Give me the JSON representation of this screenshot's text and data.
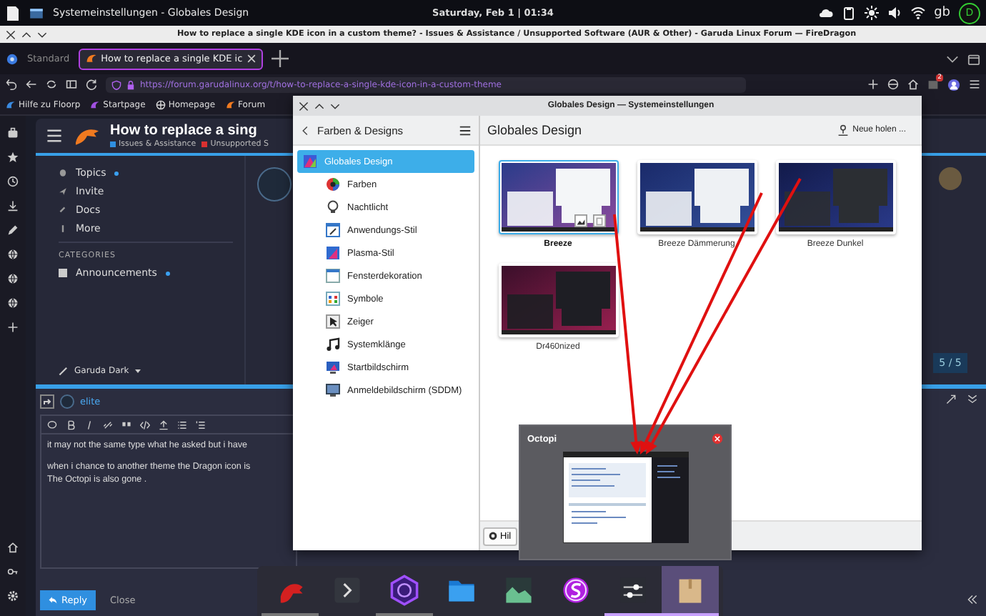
{
  "panel": {
    "window_title": "Systemeinstellungen - Globales Design",
    "clock": "Saturday, Feb 1 | 01:34",
    "keyboard_layout": "gb",
    "user_initial": "D"
  },
  "browser": {
    "title": "How to replace a single KDE icon in a custom theme? - Issues & Assistance / Unsupported Software (AUR & Other) - Garuda Linux Forum — FireDragon",
    "workspace": "Standard",
    "tabs": [
      {
        "label": "How to replace a single KDE ic",
        "selected": true
      }
    ],
    "url": "https://forum.garudalinux.org/t/how-to-replace-a-single-kde-icon-in-a-custom-theme",
    "extension_badge": "2",
    "bookmarks": [
      "Hilfe zu Floorp",
      "Startpage",
      "Homepage",
      "Forum"
    ]
  },
  "forum": {
    "topic_title": "How to replace a sing",
    "categories": [
      {
        "label": "Issues & Assistance",
        "color": "#2f8fe0"
      },
      {
        "label": "Unsupported S",
        "color": "#d83030"
      }
    ],
    "nav": [
      {
        "label": "Topics",
        "unread": true
      },
      {
        "label": "Invite",
        "unread": false
      },
      {
        "label": "Docs",
        "unread": false
      },
      {
        "label": "More",
        "unread": false
      }
    ],
    "section": "CATEGORIES",
    "category_items": [
      {
        "label": "Announcements",
        "unread": true
      }
    ],
    "theme": "Garuda Dark",
    "progress": "5 / 5",
    "reply_to": "elite",
    "draft": [
      "it may not the same type what he asked but i have",
      "when i chance to another theme the Dragon icon is",
      "The Octopi is also gone ."
    ],
    "reply_button": "Reply",
    "close_button": "Close"
  },
  "settings": {
    "title": "Globales Design — Systemeinstellungen",
    "back_label": "Farben & Designs",
    "page_title": "Globales Design",
    "get_new": "Neue holen ...",
    "nav": [
      {
        "label": "Globales Design",
        "kind": "design",
        "selected": true
      },
      {
        "label": "Farben",
        "kind": "colors",
        "selected": false
      },
      {
        "label": "Nachtlicht",
        "kind": "night",
        "selected": false
      },
      {
        "label": "Anwendungs-Stil",
        "kind": "appstyle",
        "selected": false
      },
      {
        "label": "Plasma-Stil",
        "kind": "plasma",
        "selected": false
      },
      {
        "label": "Fensterdekoration",
        "kind": "decoration",
        "selected": false
      },
      {
        "label": "Symbole",
        "kind": "icons",
        "selected": false
      },
      {
        "label": "Zeiger",
        "kind": "cursor",
        "selected": false
      },
      {
        "label": "Systemklänge",
        "kind": "sound",
        "selected": false
      },
      {
        "label": "Startbildschirm",
        "kind": "splash",
        "selected": false
      },
      {
        "label": "Anmeldebildschirm (SDDM)",
        "kind": "login",
        "selected": false
      }
    ],
    "themes": [
      {
        "name": "Breeze",
        "kind": "light",
        "selected": true
      },
      {
        "name": "Breeze Dämmerung",
        "kind": "twilight",
        "selected": false
      },
      {
        "name": "Breeze Dunkel",
        "kind": "dark",
        "selected": false
      },
      {
        "name": "Dr460nized",
        "kind": "dragon",
        "selected": false
      }
    ],
    "help_button": "Hil"
  },
  "octopi_preview": {
    "title": "Octopi"
  },
  "taskbar": [
    {
      "kind": "bird",
      "running": true,
      "selected": false
    },
    {
      "kind": "terminal",
      "running": false,
      "selected": false
    },
    {
      "kind": "hexagon",
      "running": true,
      "selected": false
    },
    {
      "kind": "folder",
      "running": false,
      "selected": false
    },
    {
      "kind": "graph",
      "running": false,
      "selected": false
    },
    {
      "kind": "ring",
      "running": false,
      "selected": false
    },
    {
      "kind": "sliders",
      "running": true,
      "selected": false
    },
    {
      "kind": "box",
      "running": true,
      "selected": true
    }
  ]
}
